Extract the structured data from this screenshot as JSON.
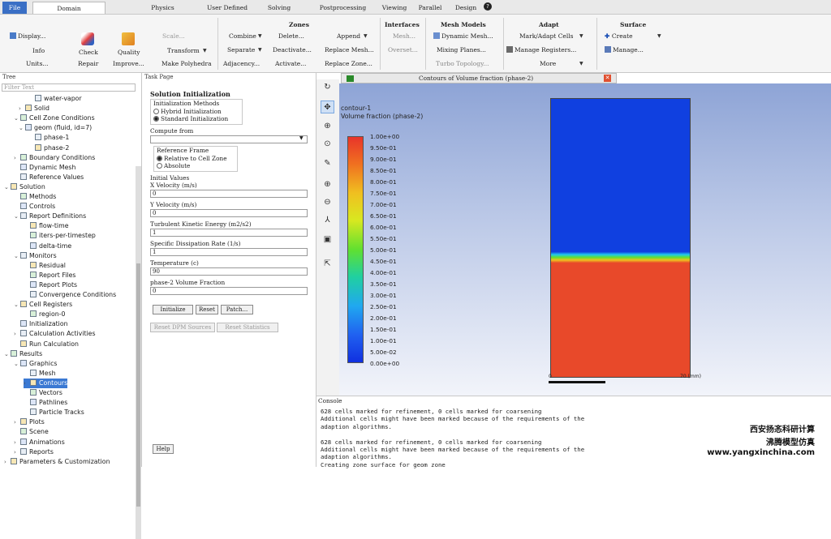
{
  "menu": {
    "file": "File",
    "tabs": [
      "Domain",
      "Physics",
      "User Defined",
      "Solving",
      "Postprocessing",
      "Viewing",
      "Parallel",
      "Design"
    ]
  },
  "ribbon": {
    "mesh_group": {
      "display": "Display...",
      "info": "Info",
      "units": "Units...",
      "check": "Check",
      "repair": "Repair",
      "quality": "Quality",
      "improve": "Improve...",
      "scale": "Scale...",
      "transform": "Transform",
      "make_polyhedra": "Make Polyhedra"
    },
    "zones": {
      "title": "Zones",
      "combine": "Combine",
      "delete": "Delete...",
      "append": "Append",
      "separate": "Separate",
      "deactivate": "Deactivate...",
      "replace_mesh": "Replace Mesh...",
      "adjacency": "Adjacency...",
      "activate": "Activate...",
      "replace_zone": "Replace Zone..."
    },
    "interfaces": {
      "title": "Interfaces",
      "mesh": "Mesh...",
      "overset": "Overset..."
    },
    "mesh_models": {
      "title": "Mesh Models",
      "dynamic_mesh": "Dynamic Mesh...",
      "mixing_planes": "Mixing Planes...",
      "turbo_topology": "Turbo Topology..."
    },
    "adapt": {
      "title": "Adapt",
      "mark_adapt": "Mark/Adapt Cells",
      "manage_registers": "Manage Registers...",
      "more": "More"
    },
    "surface": {
      "title": "Surface",
      "create": "Create",
      "manage": "Manage..."
    }
  },
  "tree": {
    "header": "Tree",
    "filter_placeholder": "Filter Text",
    "items": [
      {
        "label": "water-vapor",
        "indent": 5,
        "tw": ""
      },
      {
        "label": "Solid",
        "indent": 3,
        "tw": "›"
      },
      {
        "label": "Cell Zone Conditions",
        "indent": 2,
        "tw": "⌄"
      },
      {
        "label": "geom (fluid, id=7)",
        "indent": 3,
        "tw": "⌄"
      },
      {
        "label": "phase-1",
        "indent": 5,
        "tw": ""
      },
      {
        "label": "phase-2",
        "indent": 5,
        "tw": ""
      },
      {
        "label": "Boundary Conditions",
        "indent": 2,
        "tw": "›"
      },
      {
        "label": "Dynamic Mesh",
        "indent": 2,
        "tw": ""
      },
      {
        "label": "Reference Values",
        "indent": 2,
        "tw": ""
      },
      {
        "label": "Solution",
        "indent": 0,
        "tw": "⌄"
      },
      {
        "label": "Methods",
        "indent": 2,
        "tw": ""
      },
      {
        "label": "Controls",
        "indent": 2,
        "tw": ""
      },
      {
        "label": "Report Definitions",
        "indent": 2,
        "tw": "⌄"
      },
      {
        "label": "flow-time",
        "indent": 4,
        "tw": ""
      },
      {
        "label": "iters-per-timestep",
        "indent": 4,
        "tw": ""
      },
      {
        "label": "delta-time",
        "indent": 4,
        "tw": ""
      },
      {
        "label": "Monitors",
        "indent": 2,
        "tw": "⌄"
      },
      {
        "label": "Residual",
        "indent": 4,
        "tw": ""
      },
      {
        "label": "Report Files",
        "indent": 4,
        "tw": ""
      },
      {
        "label": "Report Plots",
        "indent": 4,
        "tw": ""
      },
      {
        "label": "Convergence Conditions",
        "indent": 4,
        "tw": ""
      },
      {
        "label": "Cell Registers",
        "indent": 2,
        "tw": "⌄"
      },
      {
        "label": "region-0",
        "indent": 4,
        "tw": ""
      },
      {
        "label": "Initialization",
        "indent": 2,
        "tw": ""
      },
      {
        "label": "Calculation Activities",
        "indent": 2,
        "tw": "›"
      },
      {
        "label": "Run Calculation",
        "indent": 2,
        "tw": ""
      },
      {
        "label": "Results",
        "indent": 0,
        "tw": "⌄"
      },
      {
        "label": "Graphics",
        "indent": 2,
        "tw": "⌄"
      },
      {
        "label": "Mesh",
        "indent": 4,
        "tw": ""
      },
      {
        "label": "Contours",
        "indent": 4,
        "tw": "›",
        "selected": true
      },
      {
        "label": "Vectors",
        "indent": 4,
        "tw": ""
      },
      {
        "label": "Pathlines",
        "indent": 4,
        "tw": ""
      },
      {
        "label": "Particle Tracks",
        "indent": 4,
        "tw": ""
      },
      {
        "label": "Plots",
        "indent": 2,
        "tw": "›"
      },
      {
        "label": "Scene",
        "indent": 2,
        "tw": ""
      },
      {
        "label": "Animations",
        "indent": 2,
        "tw": "›"
      },
      {
        "label": "Reports",
        "indent": 2,
        "tw": "›"
      },
      {
        "label": "Parameters & Customization",
        "indent": 0,
        "tw": "›"
      }
    ]
  },
  "task": {
    "header": "Task Page",
    "title": "Solution Initialization",
    "init_methods_label": "Initialization Methods",
    "hybrid": "Hybrid  Initialization",
    "standard": "Standard Initialization",
    "compute_from": "Compute from",
    "compute_from_value": "",
    "ref_frame_label": "Reference Frame",
    "relative": "Relative to Cell Zone",
    "absolute": "Absolute",
    "initial_values": "Initial Values",
    "fields": [
      {
        "label": "X Velocity (m/s)",
        "value": "0"
      },
      {
        "label": "Y Velocity (m/s)",
        "value": "0"
      },
      {
        "label": "Turbulent Kinetic Energy (m2/s2)",
        "value": "1"
      },
      {
        "label": "Specific Dissipation Rate (1/s)",
        "value": "1"
      },
      {
        "label": "Temperature (c)",
        "value": "90"
      },
      {
        "label": "phase-2 Volume Fraction",
        "value": "0"
      }
    ],
    "initialize": "Initialize",
    "reset": "Reset",
    "patch": "Patch...",
    "reset_dpm": "Reset DPM Sources",
    "reset_stats": "Reset Statistics",
    "help": "Help"
  },
  "graphics": {
    "tab_title": "Contours of Volume fraction (phase-2)",
    "contour_name": "contour-1",
    "quantity": "Volume fraction (phase-2)",
    "legend": [
      "1.00e+00",
      "9.50e-01",
      "9.00e-01",
      "8.50e-01",
      "8.00e-01",
      "7.50e-01",
      "7.00e-01",
      "6.50e-01",
      "6.00e-01",
      "5.50e-01",
      "5.00e-01",
      "4.50e-01",
      "4.00e-01",
      "3.50e-01",
      "3.00e-01",
      "2.50e-01",
      "2.00e-01",
      "1.50e-01",
      "1.00e-01",
      "5.00e-02",
      "0.00e+00"
    ],
    "scale_zero": "0",
    "scale_end": "70 (mm)",
    "interface_fraction": 0.58,
    "colors": {
      "top": "#1040e0",
      "bottom": "#e8492a"
    }
  },
  "console": {
    "title": "Console",
    "lines": [
      "628 cells marked for refinement, 0 cells marked for coarsening",
      "Additional cells might have been marked because of the requirements of the",
      "adaption algorithms.",
      "",
      "628 cells marked for refinement, 0 cells marked for coarsening",
      "Additional cells might have been marked because of the requirements of the",
      "adaption algorithms.",
      "Creating zone surface for geom zone"
    ]
  },
  "watermark": {
    "line1": "西安扬忞科研计算",
    "line2": "沸腾模型仿真",
    "line3": "www.yangxinchina.com"
  }
}
